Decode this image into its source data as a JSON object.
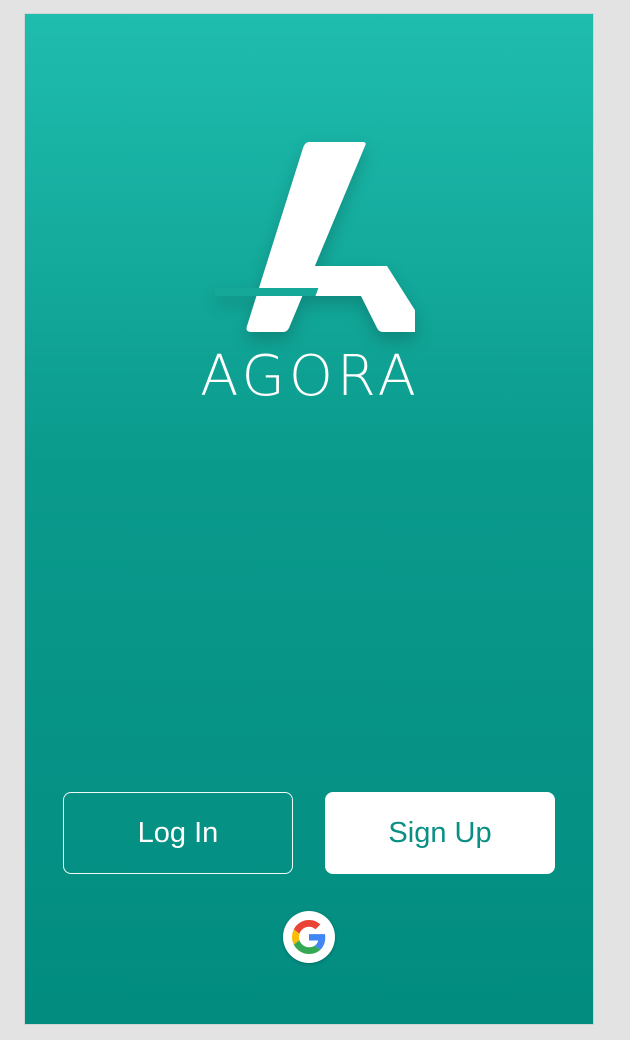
{
  "brand": {
    "name": "AGORA",
    "logo_icon": "agora-a-logo-icon"
  },
  "actions": {
    "login_label": "Log In",
    "signup_label": "Sign Up",
    "google_icon": "google-g-icon"
  },
  "colors": {
    "background_top": "#1fbdae",
    "background_bottom": "#028c80",
    "signup_text": "#0a8f84",
    "white": "#ffffff"
  }
}
